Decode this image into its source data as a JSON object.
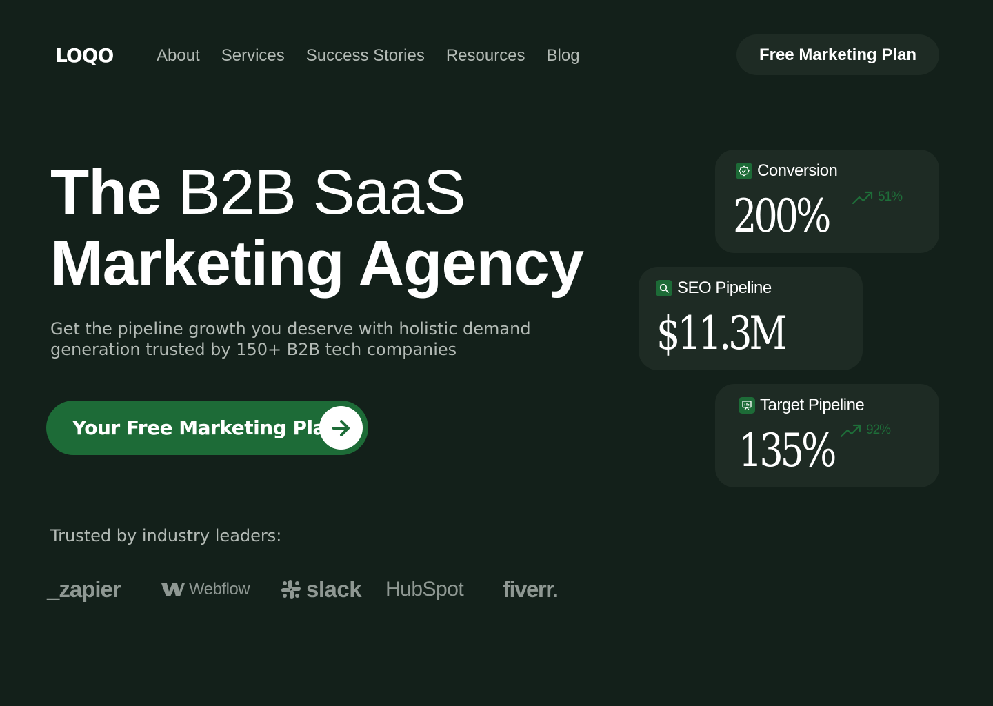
{
  "nav": {
    "logo": "LOQO",
    "links": [
      "About",
      "Services",
      "Success Stories",
      "Resources",
      "Blog"
    ],
    "cta_label": "Free Marketing Plan"
  },
  "hero": {
    "title_line1_bold": "The",
    "title_line1_light": "B2B SaaS",
    "title_line2": "Marketing Agency",
    "subtitle": "Get the pipeline growth you deserve with holistic demand generation trusted by 150+ B2B tech companies",
    "cta_label": "Your Free Marketing Plan",
    "cta_icon": "arrow-right-icon"
  },
  "trusted": {
    "label": "Trusted by industry leaders:",
    "brands": [
      "_zapier",
      "Webflow",
      "slack",
      "HubSpot",
      "fiverr."
    ]
  },
  "stats": [
    {
      "label": "Conversion",
      "value": "200%",
      "trend": "51%",
      "icon": "badge-check-icon"
    },
    {
      "label": "SEO Pipeline",
      "value": "$11.3M",
      "trend": "",
      "icon": "search-icon"
    },
    {
      "label": "Target Pipeline",
      "value": "135%",
      "trend": "92%",
      "icon": "presentation-chart-icon"
    }
  ],
  "colors": {
    "background": "#13201a",
    "card": "#1e2b24",
    "accent_green": "#1d6b37",
    "muted_text": "#b3bab5"
  }
}
